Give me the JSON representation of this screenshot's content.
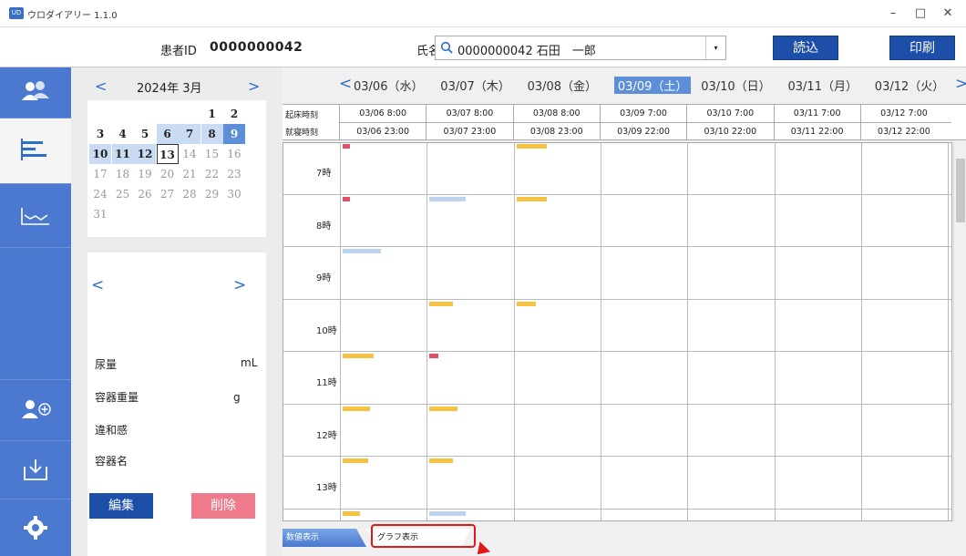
{
  "window": {
    "app_icon_text": "UD",
    "title": "ウロダイアリー 1.1.0",
    "minimize": "–",
    "maximize": "□",
    "close": "✕"
  },
  "header": {
    "patient_id_label": "患者ID",
    "patient_id_value": "0000000042",
    "name_label": "氏名",
    "name_value": "0000000042 石田　一郎",
    "dropdown_glyph": "▾",
    "load_button": "読込",
    "print_button": "印刷"
  },
  "calendar": {
    "prev": "<",
    "next": ">",
    "month_label": "2024年  3月",
    "rows": [
      [
        {
          "d": "",
          "s": ""
        },
        {
          "d": "",
          "s": ""
        },
        {
          "d": "",
          "s": ""
        },
        {
          "d": "",
          "s": ""
        },
        {
          "d": "",
          "s": ""
        },
        {
          "d": "1",
          "s": "bold"
        },
        {
          "d": "2",
          "s": "bold"
        }
      ],
      [
        {
          "d": "3",
          "s": "bold"
        },
        {
          "d": "4",
          "s": "bold"
        },
        {
          "d": "5",
          "s": "bold"
        },
        {
          "d": "6",
          "s": "bold hl"
        },
        {
          "d": "7",
          "s": "bold hl"
        },
        {
          "d": "8",
          "s": "bold hl"
        },
        {
          "d": "9",
          "s": "bold sel"
        }
      ],
      [
        {
          "d": "10",
          "s": "bold hl"
        },
        {
          "d": "11",
          "s": "bold hl"
        },
        {
          "d": "12",
          "s": "bold hl"
        },
        {
          "d": "13",
          "s": "bold today"
        },
        {
          "d": "14",
          "s": "grey"
        },
        {
          "d": "15",
          "s": "grey"
        },
        {
          "d": "16",
          "s": "grey"
        }
      ],
      [
        {
          "d": "17",
          "s": "grey"
        },
        {
          "d": "18",
          "s": "grey"
        },
        {
          "d": "19",
          "s": "grey"
        },
        {
          "d": "20",
          "s": "grey"
        },
        {
          "d": "21",
          "s": "grey"
        },
        {
          "d": "22",
          "s": "grey"
        },
        {
          "d": "23",
          "s": "grey"
        }
      ],
      [
        {
          "d": "24",
          "s": "grey"
        },
        {
          "d": "25",
          "s": "grey"
        },
        {
          "d": "26",
          "s": "grey"
        },
        {
          "d": "27",
          "s": "grey"
        },
        {
          "d": "28",
          "s": "grey"
        },
        {
          "d": "29",
          "s": "grey"
        },
        {
          "d": "30",
          "s": "grey"
        }
      ],
      [
        {
          "d": "31",
          "s": "grey"
        },
        {
          "d": "",
          "s": ""
        },
        {
          "d": "",
          "s": ""
        },
        {
          "d": "",
          "s": ""
        },
        {
          "d": "",
          "s": ""
        },
        {
          "d": "",
          "s": ""
        },
        {
          "d": "",
          "s": ""
        }
      ]
    ]
  },
  "detail": {
    "prev": "<",
    "next": ">",
    "urine_label": "尿量",
    "urine_unit": "mL",
    "container_weight_label": "容器重量",
    "container_weight_unit": "g",
    "discomfort_label": "違和感",
    "container_name_label": "容器名",
    "edit_button": "編集",
    "delete_button": "削除"
  },
  "week": {
    "prev": "<",
    "next": ">",
    "days": [
      {
        "label": "03/06（水）",
        "wake": "03/06 8:00",
        "sleep": "03/06 23:00",
        "selected": false
      },
      {
        "label": "03/07（木）",
        "wake": "03/07 8:00",
        "sleep": "03/07 23:00",
        "selected": false
      },
      {
        "label": "03/08（金）",
        "wake": "03/08 8:00",
        "sleep": "03/08 23:00",
        "selected": false
      },
      {
        "label": "03/09（土）",
        "wake": "03/09 7:00",
        "sleep": "03/09 22:00",
        "selected": true
      },
      {
        "label": "03/10（日）",
        "wake": "03/10 7:00",
        "sleep": "03/10 22:00",
        "selected": false
      },
      {
        "label": "03/11（月）",
        "wake": "03/11 7:00",
        "sleep": "03/11 22:00",
        "selected": false
      },
      {
        "label": "03/12（火）",
        "wake": "03/12 7:00",
        "sleep": "03/12 22:00",
        "selected": false
      }
    ],
    "wake_label": "起床時刻",
    "sleep_label": "就寝時刻",
    "hours": [
      "7時",
      "8時",
      "9時",
      "10時",
      "11時",
      "12時",
      "13時"
    ]
  },
  "entries": [
    {
      "day": 0,
      "hour": 7,
      "minute": 0,
      "len": 0.08,
      "color": "#e0506a"
    },
    {
      "day": 2,
      "hour": 7,
      "minute": 0,
      "len": 0.35,
      "color": "#f5c242"
    },
    {
      "day": 0,
      "hour": 8,
      "minute": 0,
      "len": 0.08,
      "color": "#e0506a"
    },
    {
      "day": 1,
      "hour": 8,
      "minute": 0,
      "len": 0.42,
      "color": "#bcd3ee"
    },
    {
      "day": 2,
      "hour": 8,
      "minute": 0,
      "len": 0.35,
      "color": "#f5c242"
    },
    {
      "day": 0,
      "hour": 9,
      "minute": 0,
      "len": 0.44,
      "color": "#bcd3ee"
    },
    {
      "day": 1,
      "hour": 10,
      "minute": 0,
      "len": 0.27,
      "color": "#f5c242"
    },
    {
      "day": 2,
      "hour": 10,
      "minute": 0,
      "len": 0.22,
      "color": "#f5c242"
    },
    {
      "day": 0,
      "hour": 11,
      "minute": 0,
      "len": 0.36,
      "color": "#f5c242"
    },
    {
      "day": 1,
      "hour": 11,
      "minute": 0,
      "len": 0.1,
      "color": "#e0506a"
    },
    {
      "day": 0,
      "hour": 12,
      "minute": 0,
      "len": 0.32,
      "color": "#f5c242"
    },
    {
      "day": 1,
      "hour": 12,
      "minute": 0,
      "len": 0.32,
      "color": "#f5c242"
    },
    {
      "day": 0,
      "hour": 13,
      "minute": 0,
      "len": 0.29,
      "color": "#f5c242"
    },
    {
      "day": 1,
      "hour": 13,
      "minute": 0,
      "len": 0.27,
      "color": "#f5c242"
    },
    {
      "day": 0,
      "hour": 14,
      "minute": 0,
      "len": 0.2,
      "color": "#f5c242"
    },
    {
      "day": 1,
      "hour": 14,
      "minute": 0,
      "len": 0.42,
      "color": "#bcd3ee"
    }
  ],
  "tabs": {
    "numeric": "数値表示",
    "graph": "グラフ表示"
  },
  "colors": {
    "sidebar": "#4a79cf",
    "button": "#1e4fa8",
    "delete_button": "#ef7a8c",
    "selected_day": "#5d8fd8",
    "highlight_day": "#c9dbf2",
    "annotation": "#e01818"
  }
}
